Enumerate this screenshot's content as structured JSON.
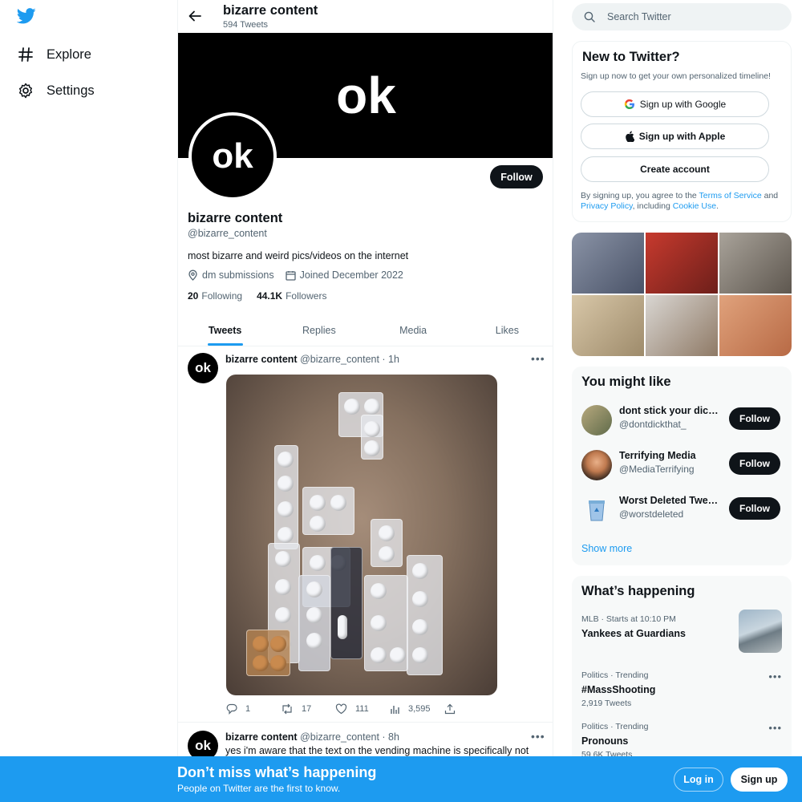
{
  "nav": {
    "logo": "twitter-bird-icon",
    "items": [
      {
        "label": "Explore",
        "icon": "hash-icon"
      },
      {
        "label": "Settings",
        "icon": "gear-icon"
      }
    ]
  },
  "profile_header": {
    "title": "bizarre content",
    "tweet_count": "594 Tweets"
  },
  "profile": {
    "banner_text": "ok",
    "avatar_text": "ok",
    "follow_label": "Follow",
    "name": "bizarre content",
    "handle": "@bizarre_content",
    "bio": "most bizarre and weird pics/videos on the internet",
    "location": "dm submissions",
    "joined": "Joined December 2022",
    "following_count": "20",
    "following_label": "Following",
    "followers_count": "44.1K",
    "followers_label": "Followers"
  },
  "tabs": [
    {
      "label": "Tweets",
      "active": true
    },
    {
      "label": "Replies",
      "active": false
    },
    {
      "label": "Media",
      "active": false
    },
    {
      "label": "Likes",
      "active": false
    }
  ],
  "tweets": [
    {
      "avatar_text": "ok",
      "name": "bizarre content",
      "meta": "@bizarre_content · 1h",
      "replies": "1",
      "retweets": "17",
      "likes": "111",
      "views": "3,595"
    },
    {
      "avatar_text": "ok",
      "name": "bizarre content",
      "meta": "@bizarre_content · 8h",
      "text": "yes i'm aware that the text on the vending machine is specifically not"
    }
  ],
  "search": {
    "placeholder": "Search Twitter"
  },
  "new_to_twitter": {
    "title": "New to Twitter?",
    "subtitle": "Sign up now to get your own personalized timeline!",
    "google_label": "Sign up with Google",
    "apple_label": "Sign up with Apple",
    "create_label": "Create account",
    "legal_1": "By signing up, you agree to the ",
    "terms": "Terms of Service",
    "legal_2": " and ",
    "privacy": "Privacy Policy",
    "legal_3": ", including ",
    "cookie": "Cookie Use",
    "legal_4": "."
  },
  "you_might_like": {
    "title": "You might like",
    "accounts": [
      {
        "name": "dont stick your dick in that",
        "handle": "@dontdickthat_",
        "follow": "Follow"
      },
      {
        "name": "Terrifying Media",
        "handle": "@MediaTerrifying",
        "follow": "Follow"
      },
      {
        "name": "Worst Deleted Tweets",
        "handle": "@worstdeleted",
        "follow": "Follow"
      }
    ],
    "show_more": "Show more"
  },
  "whats_happening": {
    "title": "What’s happening",
    "trends": [
      {
        "meta": "MLB · Starts at 10:10 PM",
        "title": "Yankees at Guardians",
        "count": ""
      },
      {
        "meta": "Politics · Trending",
        "title": "#MassShooting",
        "count": "2,919 Tweets"
      },
      {
        "meta": "Politics · Trending",
        "title": "Pronouns",
        "count": "59.6K Tweets"
      }
    ]
  },
  "bottom_bar": {
    "title": "Don’t miss what’s happening",
    "subtitle": "People on Twitter are the first to know.",
    "login": "Log in",
    "signup": "Sign up"
  },
  "colors": {
    "accent": "#1d9bf0",
    "dark": "#0f1419",
    "muted": "#536471"
  }
}
